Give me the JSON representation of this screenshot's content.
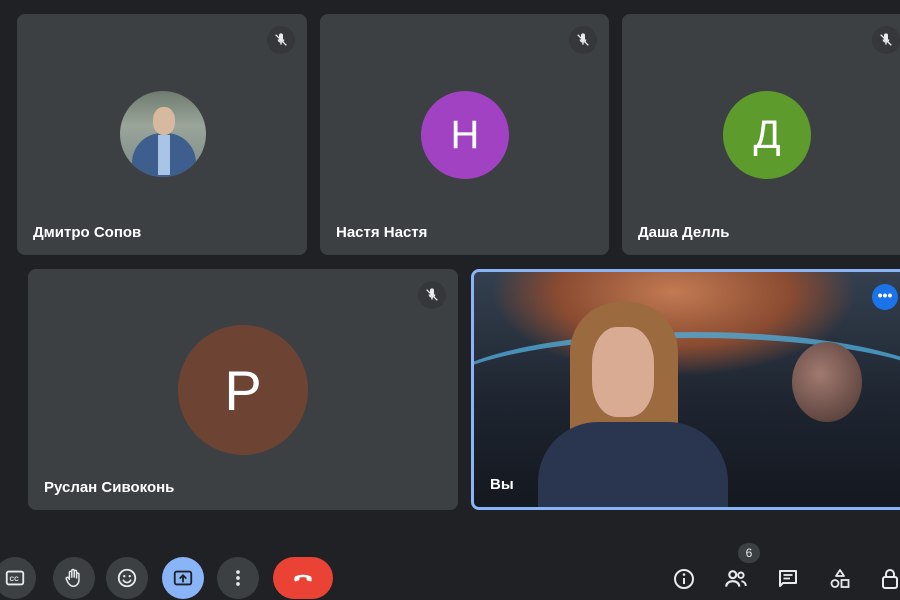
{
  "participants": [
    {
      "name": "Дмитро Сопов",
      "avatar_type": "photo",
      "muted": true
    },
    {
      "name": "Настя Настя",
      "avatar_letter": "Н",
      "avatar_color": "#a142c3",
      "muted": true
    },
    {
      "name": "Даша Делль",
      "avatar_letter": "Д",
      "avatar_color": "#5e9b2d",
      "muted": true
    },
    {
      "name": "Руслан Сивоконь",
      "avatar_letter": "Р",
      "avatar_color": "#6d4434",
      "muted": true
    },
    {
      "name": "Вы",
      "avatar_type": "video",
      "highlight_color": "#8ab4f8"
    }
  ],
  "toolbar": {
    "icons": [
      "captions-icon",
      "raise-hand-icon",
      "emoji-icon",
      "present-icon",
      "more-vert-icon",
      "call-end-icon"
    ],
    "leave_color": "#ea4335",
    "present_color": "#8ab4f8"
  },
  "right_toolbar": {
    "icons": [
      "info-icon",
      "people-icon",
      "chat-icon",
      "activities-icon",
      "host-controls-icon"
    ],
    "people_count": "6"
  }
}
